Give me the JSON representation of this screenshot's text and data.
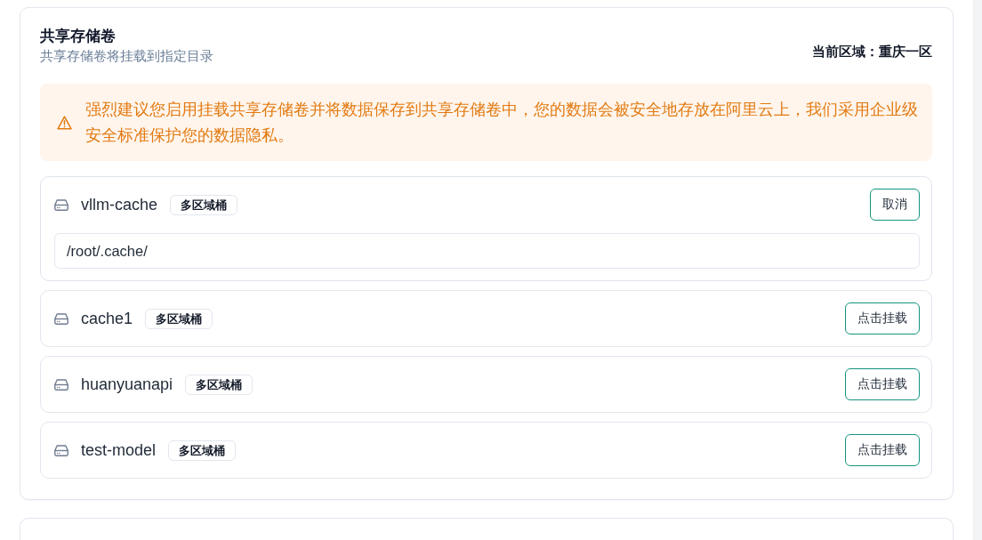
{
  "section": {
    "title": "共享存储卷",
    "subtitle": "共享存储卷将挂载到指定目录",
    "region": "当前区域：重庆一区"
  },
  "alert": {
    "text": "强烈建议您启用挂载共享存储卷并将数据保存到共享存储卷中，您的数据会被安全地存放在阿里云上，我们采用企业级安全标准保护您的数据隐私。"
  },
  "volumes": [
    {
      "name": "vllm-cache",
      "tag": "多区域桶",
      "selected": true,
      "mount_path": "/root/.cache/",
      "action": "取消"
    },
    {
      "name": "cache1",
      "tag": "多区域桶",
      "selected": false,
      "action": "点击挂载"
    },
    {
      "name": "huanyuanapi",
      "tag": "多区域桶",
      "selected": false,
      "action": "点击挂载"
    },
    {
      "name": "test-model",
      "tag": "多区域桶",
      "selected": false,
      "action": "点击挂载"
    }
  ]
}
